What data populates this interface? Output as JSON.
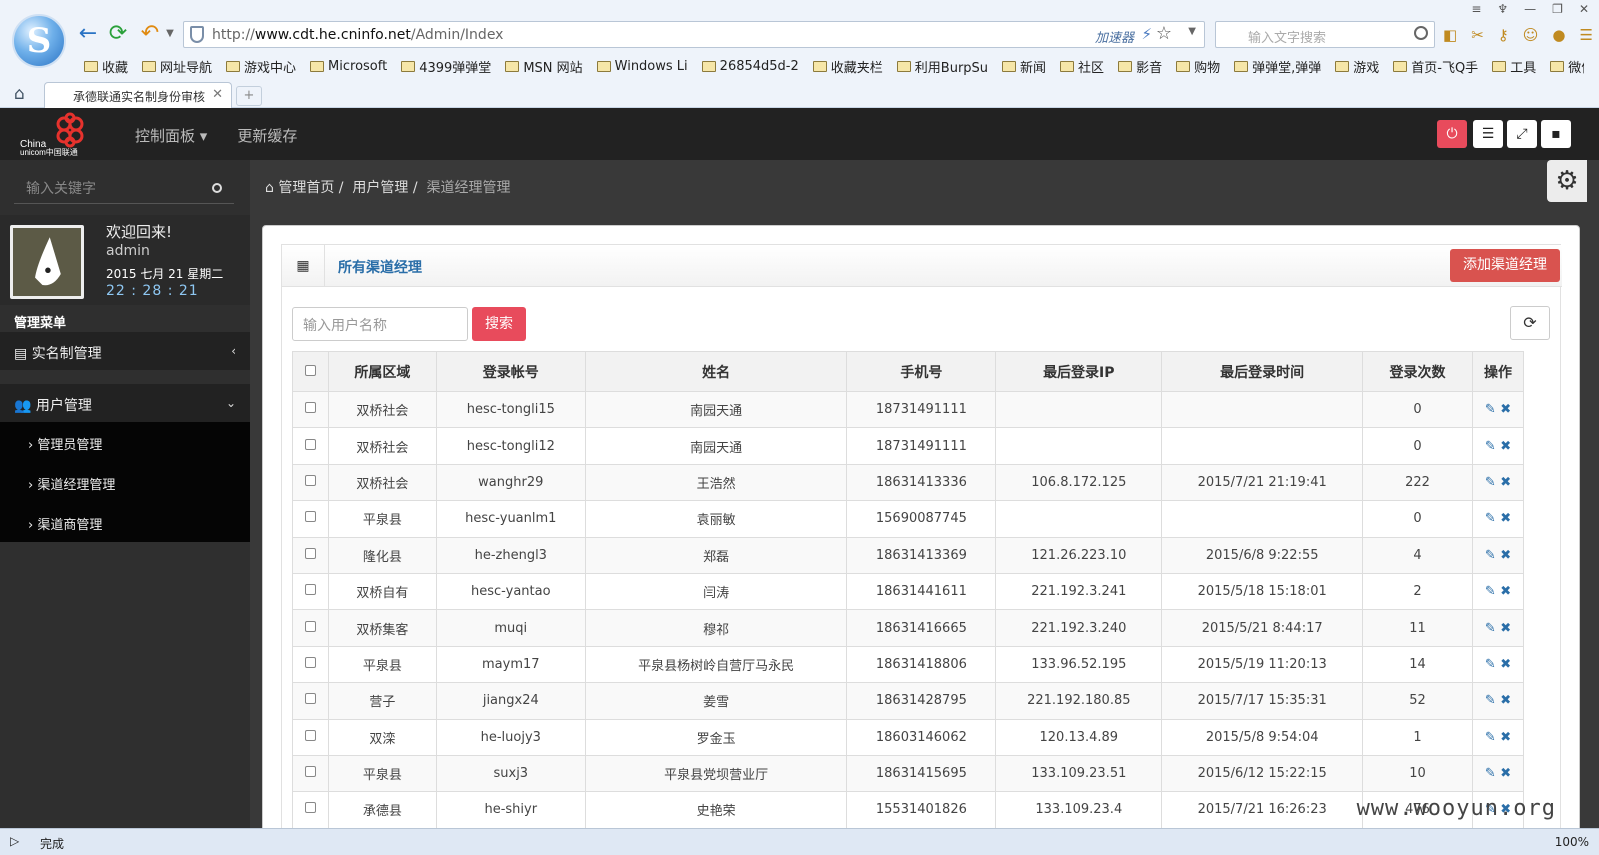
{
  "browser": {
    "url_prefix": "http://",
    "url_host": "www.cdt.he.cninfo.net",
    "url_path": "/Admin/Index",
    "accelerator": "加速器",
    "search_placeholder": "输入文字搜索",
    "bookmarks": [
      "收藏",
      "网址导航",
      "游戏中心",
      "Microsoft",
      "4399弹弹堂",
      "MSN 网站",
      "Windows Li",
      "26854d5d-2",
      "收藏夹栏",
      "利用BurpSu",
      "新闻",
      "社区",
      "影音",
      "购物",
      "弹弹堂,弹弹",
      "游戏",
      "首页-飞Q手",
      "工具",
      "微信活动网"
    ],
    "tab_title": "承德联通实名制身份审核",
    "status_text": "完成",
    "zoom": "100%"
  },
  "app": {
    "top_nav": [
      "控制面板 ▾",
      "更新缓存"
    ],
    "sidebar": {
      "search_placeholder": "输入关键字",
      "welcome": "欢迎回来!",
      "username": "admin",
      "date": "2015 七月 21 星期二",
      "clock": "22 : 28 : 21",
      "menu_header": "管理菜单",
      "menus": [
        {
          "label": "实名制管理"
        },
        {
          "label": "用户管理"
        }
      ],
      "submenus": [
        "管理员管理",
        "渠道经理管理",
        "渠道商管理"
      ]
    },
    "breadcrumb": [
      "管理首页",
      "用户管理",
      "渠道经理管理"
    ],
    "panel": {
      "title": "所有渠道经理",
      "add_button": "添加渠道经理",
      "search_placeholder": "输入用户名称",
      "search_button": "搜索"
    },
    "table": {
      "headers": [
        "所属区域",
        "登录帐号",
        "姓名",
        "手机号",
        "最后登录IP",
        "最后登录时间",
        "登录次数",
        "操作"
      ],
      "rows": [
        [
          "双桥社会",
          "hesc-tongli15",
          "南园天通",
          "18731491111",
          "",
          "",
          "0"
        ],
        [
          "双桥社会",
          "hesc-tongli12",
          "南园天通",
          "18731491111",
          "",
          "",
          "0"
        ],
        [
          "双桥社会",
          "wanghr29",
          "王浩然",
          "18631413336",
          "106.8.172.125",
          "2015/7/21 21:19:41",
          "222"
        ],
        [
          "平泉县",
          "hesc-yuanlm1",
          "袁丽敏",
          "15690087745",
          "",
          "",
          "0"
        ],
        [
          "隆化县",
          "he-zhengl3",
          "郑磊",
          "18631413369",
          "121.26.223.10",
          "2015/6/8 9:22:55",
          "4"
        ],
        [
          "双桥自有",
          "hesc-yantao",
          "闫涛",
          "18631441611",
          "221.192.3.241",
          "2015/5/18 15:18:01",
          "2"
        ],
        [
          "双桥集客",
          "muqi",
          "穆祁",
          "18631416665",
          "221.192.3.240",
          "2015/5/21 8:44:17",
          "11"
        ],
        [
          "平泉县",
          "maym17",
          "平泉县杨树岭自营厅马永民",
          "18631418806",
          "133.96.52.195",
          "2015/5/19 11:20:13",
          "14"
        ],
        [
          "营子",
          "jiangx24",
          "姜雪",
          "18631428795",
          "221.192.180.85",
          "2015/7/17 15:35:31",
          "52"
        ],
        [
          "双滦",
          "he-luojy3",
          "罗金玉",
          "18603146062",
          "120.13.4.89",
          "2015/5/8 9:54:04",
          "1"
        ],
        [
          "平泉县",
          "suxj3",
          "平泉县党坝营业厅",
          "18631415695",
          "133.109.23.51",
          "2015/6/12 15:22:15",
          "10"
        ],
        [
          "承德县",
          "he-shiyr",
          "史艳荣",
          "15531401826",
          "133.109.23.4",
          "2015/7/21 16:26:23",
          "476"
        ]
      ]
    }
  },
  "watermark": "www.wooyun.org"
}
